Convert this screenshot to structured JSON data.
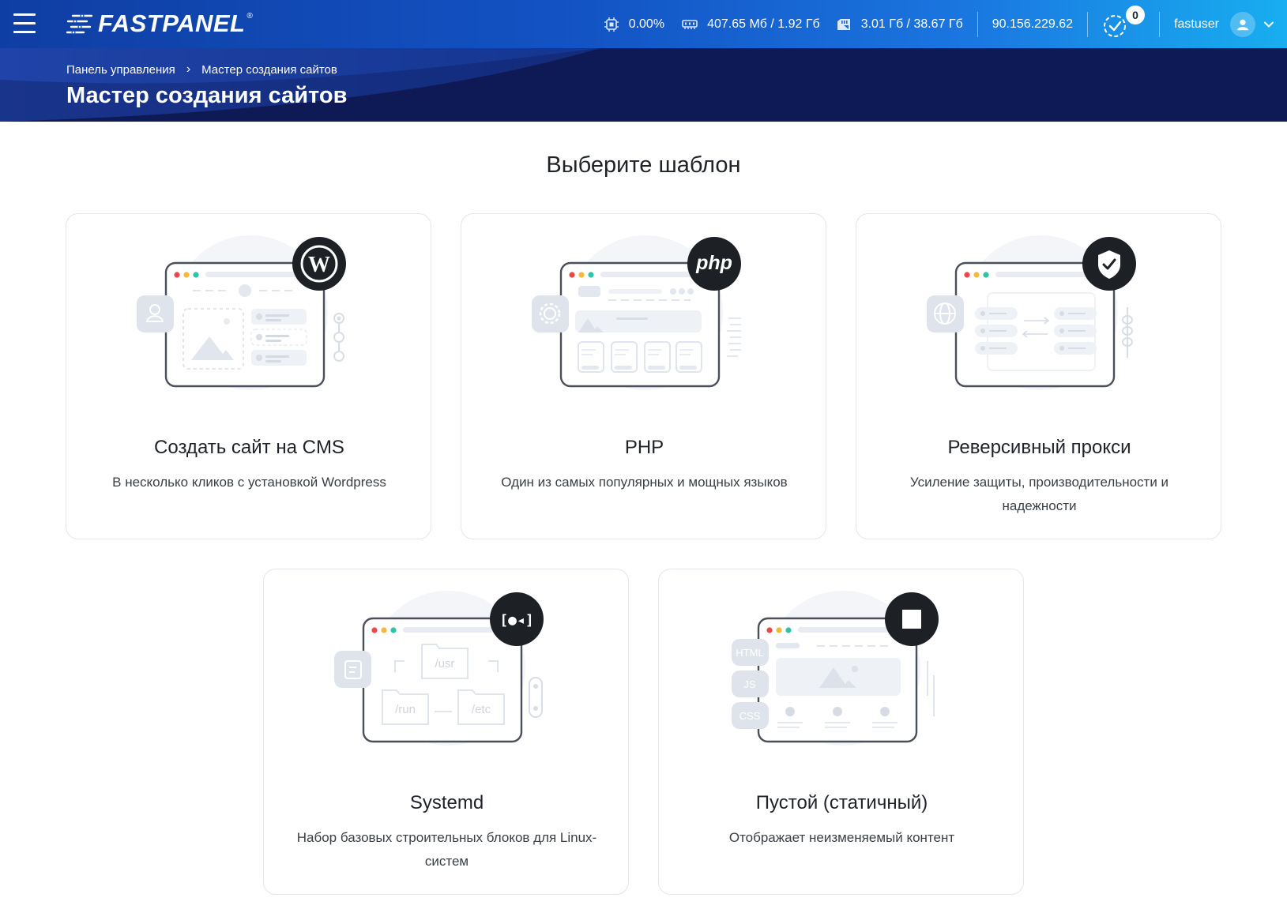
{
  "header": {
    "logo_text": "FASTPANEL",
    "logo_reg": "®",
    "cpu": "0.00%",
    "ram": "407.65 Мб / 1.92 Гб",
    "disk": "3.01 Гб / 38.67 Гб",
    "ip": "90.156.229.62",
    "notifications_count": "0",
    "username": "fastuser",
    "icons": [
      "menu-icon",
      "cpu-icon",
      "ram-icon",
      "disk-icon",
      "tasks-check-icon",
      "user-icon",
      "chevron-down-icon"
    ],
    "gradient_colors": [
      "#0f3ea3",
      "#18aef0"
    ]
  },
  "hero": {
    "breadcrumb": {
      "home": "Панель управления",
      "separator": "›",
      "current": "Мастер создания сайтов"
    },
    "title": "Мастер создания сайтов",
    "background": "#0e1a55"
  },
  "main": {
    "section_title": "Выберите шаблон",
    "cards": [
      {
        "title": "Создать сайт на CMS",
        "description": "В несколько кликов с установкой Wordpress",
        "badge_icon": "wordpress-icon"
      },
      {
        "title": "PHP",
        "description": "Один из самых популярных и мощных языков",
        "badge_icon": "php-icon",
        "badge_text": "php"
      },
      {
        "title": "Реверсивный прокси",
        "description": "Усиление защиты, производительности и надежности",
        "badge_icon": "shield-check-icon"
      },
      {
        "title": "Systemd",
        "description": "Набор базовых строительных блоков для Linux-систем",
        "badge_icon": "systemd-icon",
        "badge_text": "[●◂]",
        "folders": [
          "/usr",
          "/run",
          "/etc"
        ]
      },
      {
        "title": "Пустой (статичный)",
        "description": "Отображает неизменяемый контент",
        "badge_icon": "stop-square-icon",
        "tags": [
          "HTML",
          "JS",
          "CSS"
        ]
      }
    ]
  },
  "colors": {
    "dot_red": "#f0454a",
    "dot_yellow": "#f5b83d",
    "dot_green": "#2ec4a6",
    "outline": "#4a4f5a",
    "soft": "#e8ebf2",
    "badge": "#1d2025"
  }
}
